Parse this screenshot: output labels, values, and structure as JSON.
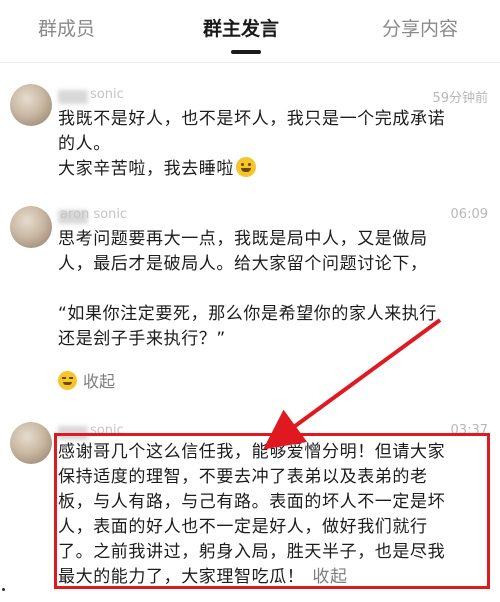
{
  "tabs": [
    {
      "label": "群成员"
    },
    {
      "label": "群主发言"
    },
    {
      "label": "分享内容"
    }
  ],
  "posts": [
    {
      "username": "sonic",
      "time": "59分钟前",
      "lines": [
        "我既不是好人，也不是坏人，我只是一个完成承诺",
        "的人。",
        "大家辛苦啦，我去睡啦"
      ]
    },
    {
      "username": "aron sonic",
      "time": "06:09",
      "lines": [
        "思考问题要再大一点，我既是局中人，又是做局",
        "人，最后才是破局人。给大家留个问题讨论下，",
        "",
        "“如果你注定要死，那么你是希望你的家人来执行",
        "还是刽子手来执行？”"
      ],
      "collapse_label": "收起"
    },
    {
      "username": "sonic",
      "time": "03:37",
      "lines": [
        "感谢哥几个这么信任我，能够爱憎分明！但请大家",
        "保持适度的理智，不要去冲了表弟以及表弟的老",
        "板，与人有路，与己有路。表面的坏人不一定是坏",
        "人，表面的好人也不一定是好人，做好我们就行",
        "了。之前我讲过，躬身入局，胜天半子，也是尽我",
        "最大的能力了，大家理智吃瓜！"
      ],
      "collapse_label": "收起"
    }
  ],
  "colors": {
    "annotation": "#e01820",
    "active_tab": "#1a1a1a"
  },
  "icons": {
    "emoji_1": "grinning-sweat-emoji",
    "emoji_2": "smile-emoji"
  }
}
